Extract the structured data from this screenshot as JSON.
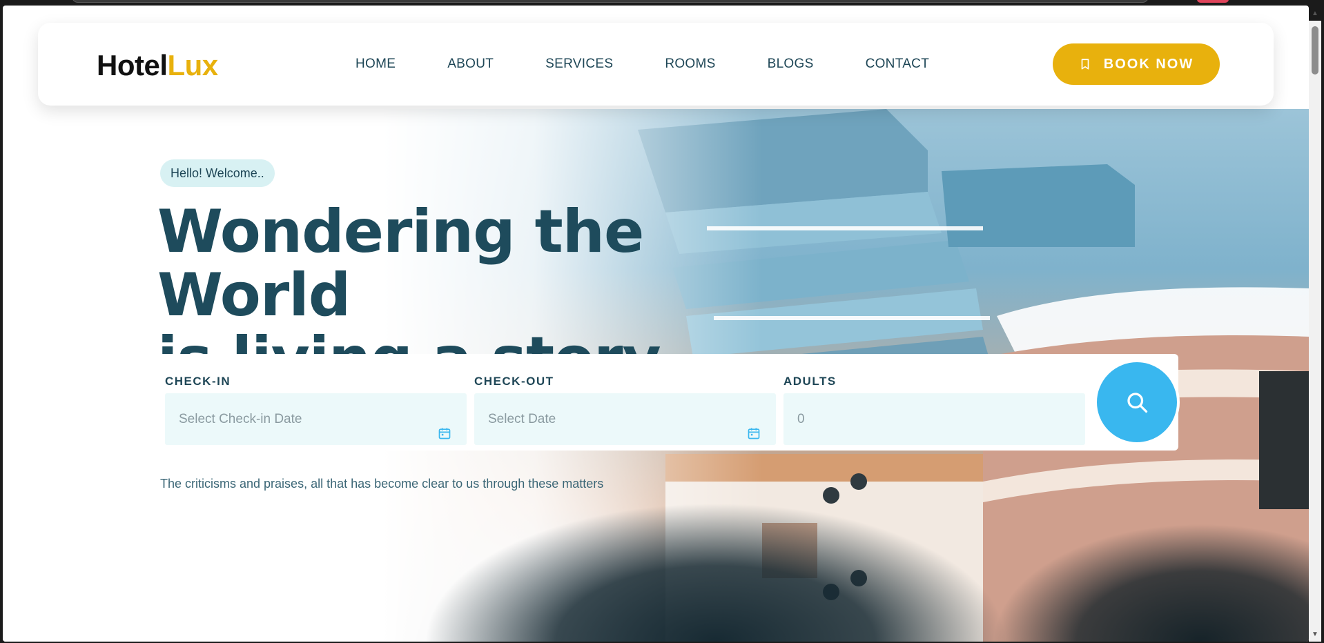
{
  "brand": {
    "name_part1": "Hotel",
    "name_part2": "Lux"
  },
  "nav": {
    "items": [
      "HOME",
      "ABOUT",
      "SERVICES",
      "ROOMS",
      "BLOGS",
      "CONTACT"
    ],
    "book_label": "BOOK NOW",
    "book_icon": "bookmark-icon"
  },
  "hero": {
    "badge": "Hello! Welcome..",
    "headline_line1": "Wondering the World",
    "headline_line2": "is living a story untold.",
    "tagline": "The criticisms and praises, all that has become clear to us through these matters"
  },
  "booking": {
    "checkin_label": "CHECK-IN",
    "checkin_placeholder": "Select Check-in Date",
    "checkout_label": "CHECK-OUT",
    "checkout_placeholder": "Select Date",
    "adults_label": "ADULTS",
    "adults_value": "0",
    "search_icon": "search-icon"
  },
  "colors": {
    "accent": "#e8b10d",
    "primary_text": "#1e4b5c",
    "search_button": "#39b7ef",
    "badge_bg": "#d8f1f3",
    "input_bg": "#ecf9fa"
  }
}
